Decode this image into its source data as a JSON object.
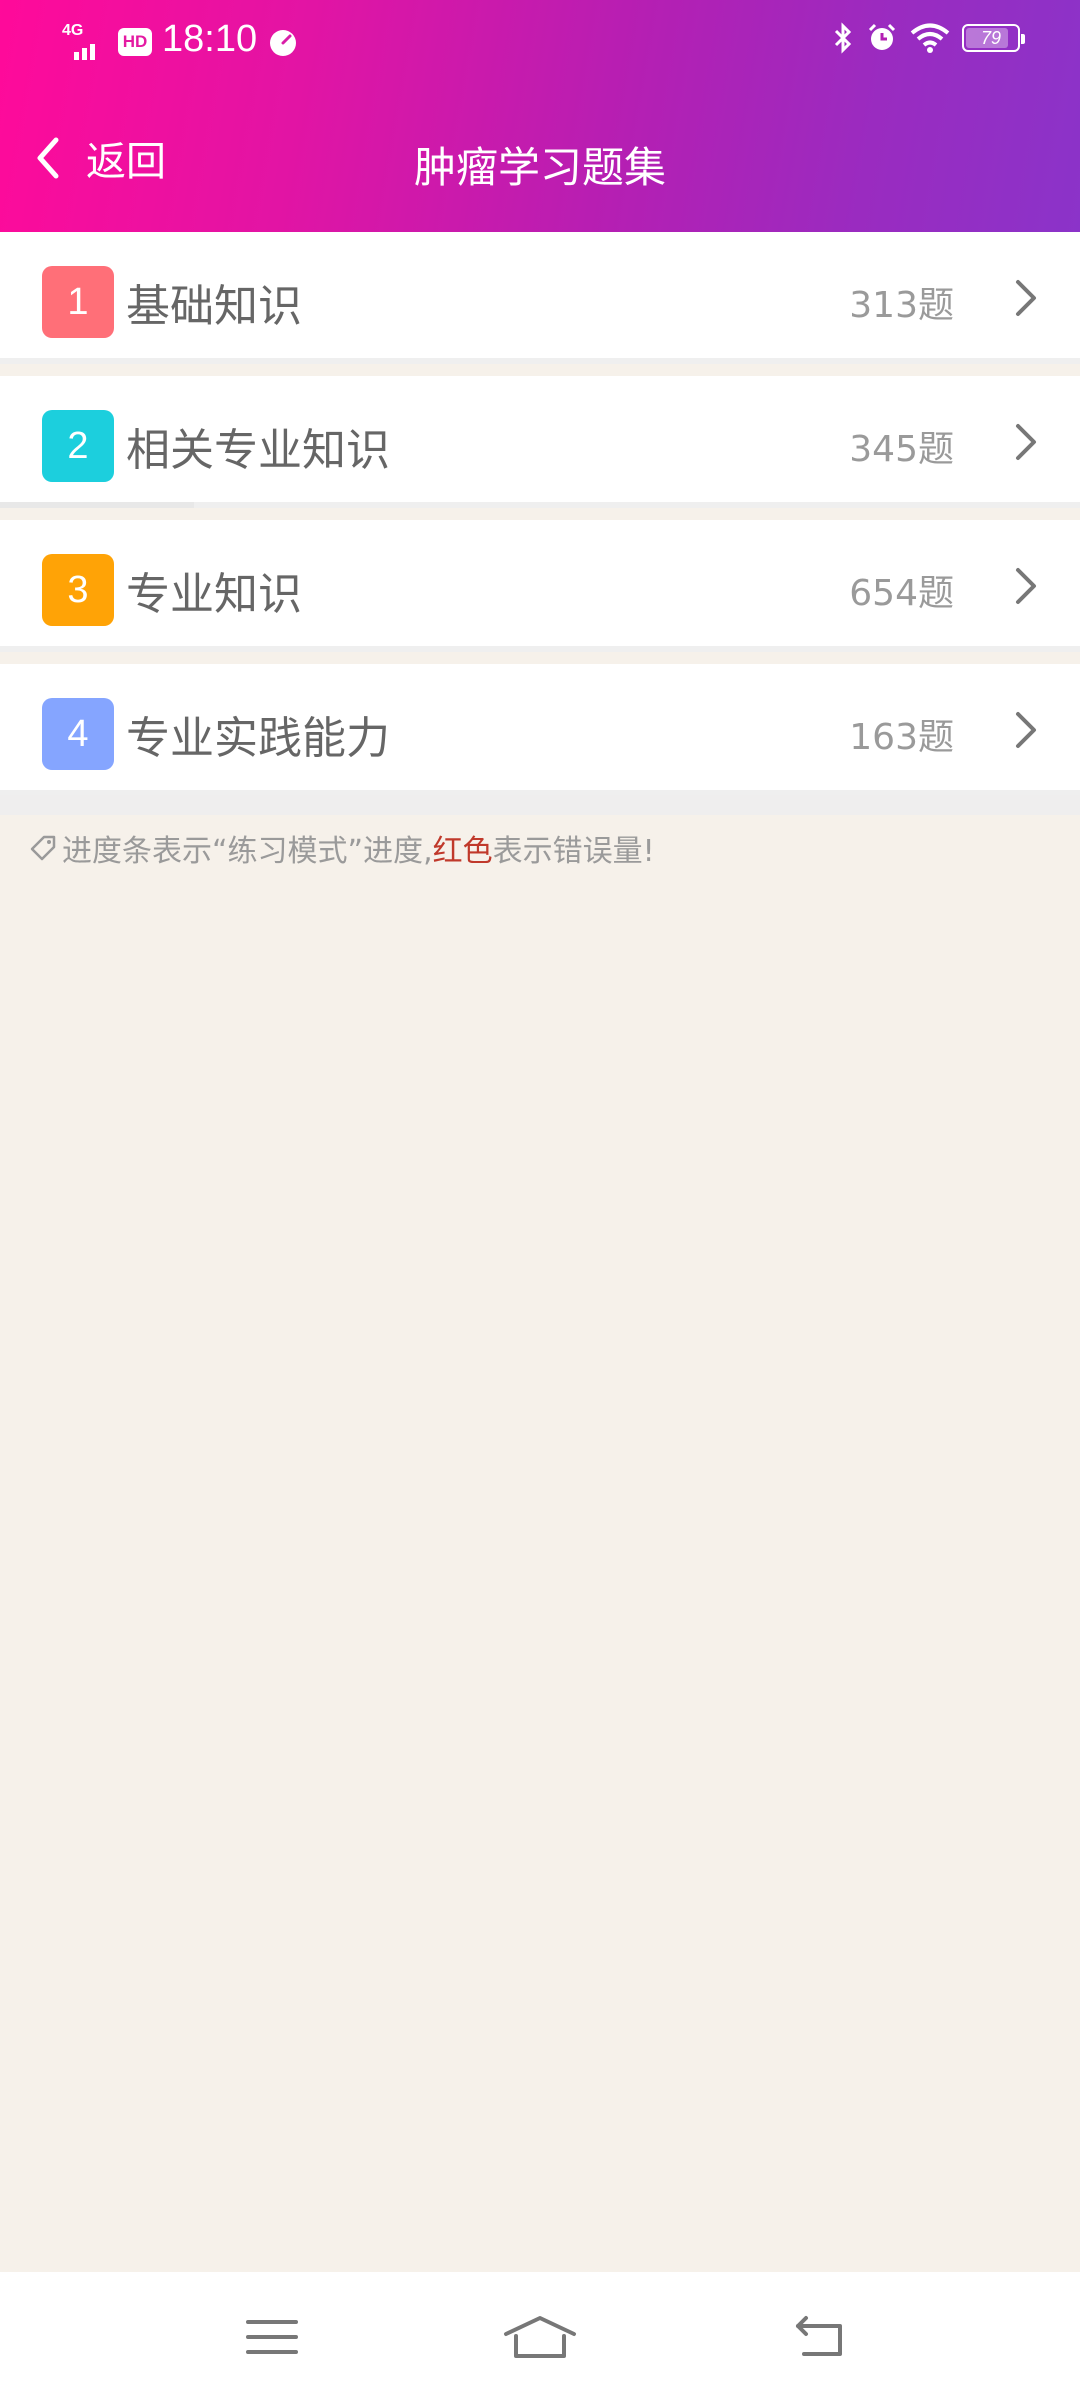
{
  "status_bar": {
    "network": "4G",
    "hd": "HD",
    "time": "18:10",
    "battery": "79"
  },
  "nav": {
    "back_label": "返回",
    "title": "肿瘤学习题集"
  },
  "items": [
    {
      "index": "1",
      "title": "基础知识",
      "count": "313题",
      "color": "#ff6f78",
      "progress": 0
    },
    {
      "index": "2",
      "title": "相关专业知识",
      "count": "345题",
      "color": "#1ccfdd",
      "progress": 0.18
    },
    {
      "index": "3",
      "title": "专业知识",
      "count": "654题",
      "color": "#ffa306",
      "progress": 0
    },
    {
      "index": "4",
      "title": "专业实践能力",
      "count": "163题",
      "color": "#85a5ff",
      "progress": 0
    }
  ],
  "hint": {
    "prefix": "进度条表示“练习模式”进度,",
    "red_text": "红色",
    "suffix": "表示错误量!"
  },
  "icons": {
    "back": "chevron-left-icon",
    "arrow": "chevron-right-icon",
    "tag": "tag-icon",
    "menu": "menu-icon",
    "home": "home-icon",
    "back_sys": "back-icon"
  }
}
